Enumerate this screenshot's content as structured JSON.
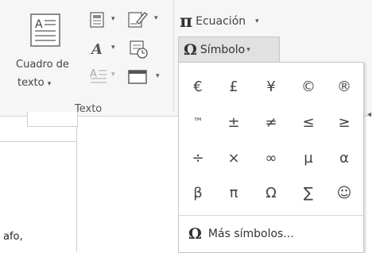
{
  "ribbon": {
    "text_box": {
      "label_line1": "Cuadro de",
      "label_line2": "texto",
      "caret": "▾"
    },
    "group_label": "Texto",
    "equation": {
      "symbol": "π",
      "label": "Ecuación",
      "caret": "▾"
    },
    "symbol_button": {
      "symbol": "Ω",
      "label": "Símbolo",
      "caret": "▾"
    }
  },
  "symbols_dropdown": {
    "symbols": [
      "€",
      "£",
      "¥",
      "©",
      "®",
      "™",
      "±",
      "≠",
      "≤",
      "≥",
      "÷",
      "×",
      "∞",
      "µ",
      "α",
      "β",
      "π",
      "Ω",
      "∑",
      "☺"
    ],
    "more": {
      "symbol": "Ω",
      "label": "Más símbolos..."
    }
  },
  "document": {
    "text": "afo,"
  }
}
